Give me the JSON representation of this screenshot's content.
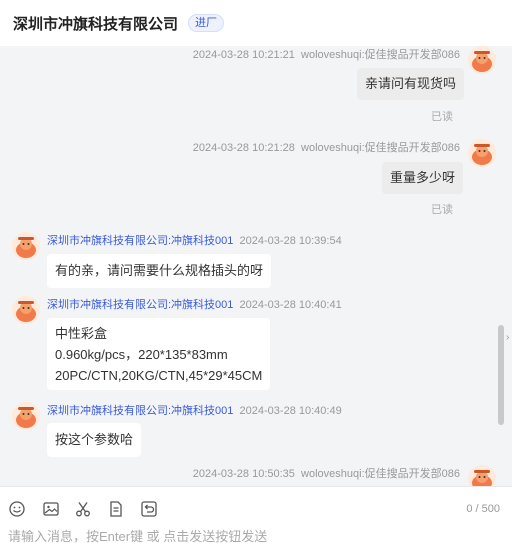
{
  "header": {
    "title": "深圳市冲旗科技有限公司",
    "badge": "进厂"
  },
  "messages": [
    {
      "time": "2024-03-28 10:21:21",
      "sender": "woloveshuqi:促佳搜品开发部086",
      "lines": [
        "亲请问有现货吗"
      ],
      "status": "已读"
    },
    {
      "time": "2024-03-28 10:21:28",
      "sender": "woloveshuqi:促佳搜品开发部086",
      "lines": [
        "重量多少呀"
      ],
      "status": "已读"
    },
    {
      "time": "2024-03-28 10:39:54",
      "sender": "深圳市冲旗科技有限公司:冲旗科技001",
      "lines": [
        "有的亲，请问需要什么规格插头的呀"
      ]
    },
    {
      "time": "2024-03-28 10:40:41",
      "sender": "深圳市冲旗科技有限公司:冲旗科技001",
      "lines": [
        "中性彩盒",
        "0.960kg/pcs，220*135*83mm",
        "20PC/CTN,20KG/CTN,45*29*45CM"
      ]
    },
    {
      "time": "2024-03-28 10:40:49",
      "sender": "深圳市冲旗科技有限公司:冲旗科技001",
      "lines": [
        "按这个参数哈"
      ]
    },
    {
      "time": "2024-03-28 10:50:35",
      "sender": "woloveshuqi:促佳搜品开发部086",
      "lines": []
    }
  ],
  "composer": {
    "counter": "0 / 500",
    "placeholder": "请输入消息，按Enter键 或 点击发送按钮发送"
  },
  "icons": [
    "emoji-icon",
    "image-icon",
    "scissors-icon",
    "order-icon",
    "recall-icon"
  ],
  "colors": {
    "accent": "#3a5bd9",
    "avatar": "#f07a4a"
  }
}
